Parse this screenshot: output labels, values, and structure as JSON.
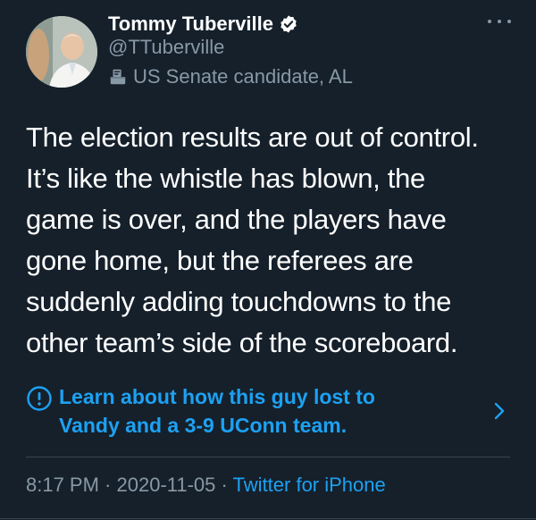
{
  "user": {
    "display_name": "Tommy Tuberville",
    "handle": "@TTuberville",
    "label": "US Senate candidate, AL",
    "verified": true
  },
  "tweet": {
    "lines": [
      "The election results are out of control.",
      "It’s like the whistle has blown, the",
      "game is over, and the players have",
      "gone home, but the referees are",
      "suddenly adding touchdowns to the",
      "other team’s side of the scoreboard."
    ]
  },
  "notice": {
    "lines": [
      "Learn about how this guy lost to",
      "Vandy and a 3-9 UConn team."
    ]
  },
  "meta": {
    "time": "8:17 PM",
    "separator1": " · ",
    "date": "2020-11-05",
    "separator2": " · ",
    "source": "Twitter for iPhone"
  },
  "colors": {
    "background": "#15202b",
    "accent": "#1da1f2",
    "secondary_text": "#8899a6"
  },
  "icons": {
    "verified": "verified-badge-icon",
    "ballot": "ballot-box-icon",
    "more": "more-options-icon",
    "info": "info-circle-icon",
    "chevron": "chevron-right-icon"
  }
}
